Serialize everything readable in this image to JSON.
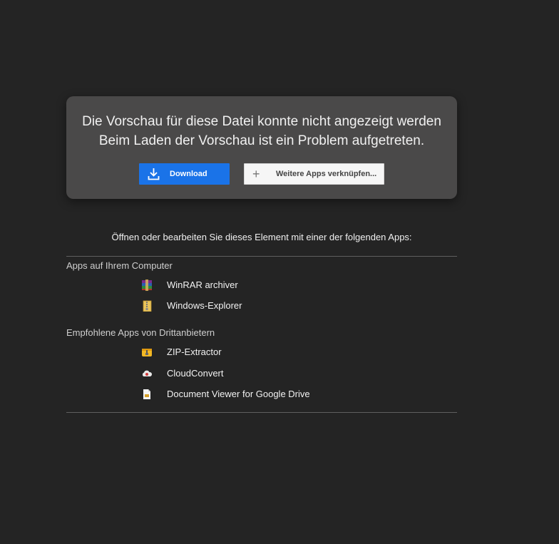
{
  "preview": {
    "title": "Die Vorschau für diese Datei konnte nicht angezeigt werden",
    "subtitle": "Beim Laden der Vorschau ist ein Problem aufgetreten.",
    "download_label": "Download",
    "connect_apps_label": "Weitere Apps verknüpfen..."
  },
  "open_with": {
    "heading": "Öffnen oder bearbeiten Sie dieses Element mit einer der folgenden Apps:",
    "computer_section": {
      "label": "Apps auf Ihrem Computer",
      "apps": [
        {
          "name": "WinRAR archiver",
          "icon": "winrar-icon"
        },
        {
          "name": "Windows-Explorer",
          "icon": "zip-folder-icon"
        }
      ]
    },
    "third_party_section": {
      "label": "Empfohlene Apps von Drittanbietern",
      "apps": [
        {
          "name": "ZIP-Extractor",
          "icon": "zip-extractor-icon"
        },
        {
          "name": "CloudConvert",
          "icon": "cloudconvert-icon"
        },
        {
          "name": "Document Viewer for Google Drive",
          "icon": "document-viewer-icon"
        }
      ]
    }
  },
  "colors": {
    "background": "#242424",
    "card": "#4a4949",
    "accent": "#1a73e8"
  }
}
